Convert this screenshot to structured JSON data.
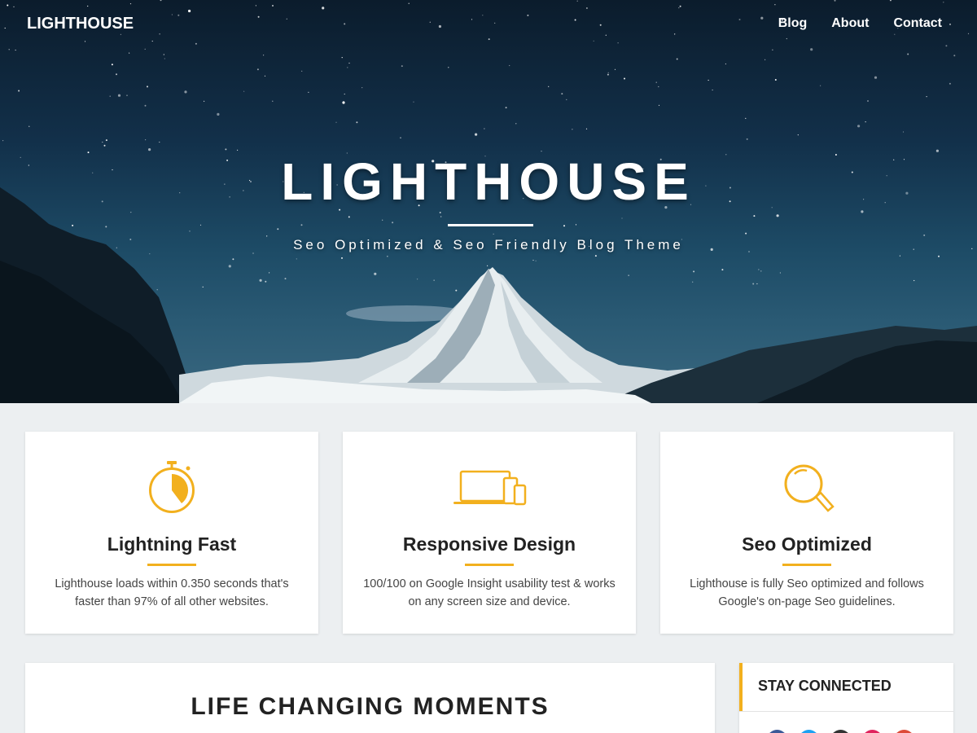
{
  "nav": {
    "brand": "LIGHTHOUSE",
    "links": [
      "Blog",
      "About",
      "Contact"
    ]
  },
  "hero": {
    "title": "LIGHTHOUSE",
    "subtitle": "Seo Optimized & Seo Friendly Blog Theme"
  },
  "features": [
    {
      "icon": "stopwatch-icon",
      "title": "Lightning Fast",
      "text": "Lighthouse loads within 0.350 seconds that's faster than 97% of all other websites."
    },
    {
      "icon": "devices-icon",
      "title": "Responsive Design",
      "text": "100/100 on Google Insight usability test & works on any screen size and device."
    },
    {
      "icon": "magnifier-icon",
      "title": "Seo Optimized",
      "text": "Lighthouse is fully Seo optimized and follows Google's on-page Seo guidelines."
    }
  ],
  "main": {
    "heading": "LIFE CHANGING MOMENTS"
  },
  "sidebar": {
    "heading": "STAY CONNECTED",
    "social_colors": [
      "#3b5998",
      "#1da1f2",
      "#333333",
      "#e0245e",
      "#dd4b39"
    ]
  },
  "colors": {
    "accent": "#f2b01e",
    "background": "#eceff1"
  }
}
